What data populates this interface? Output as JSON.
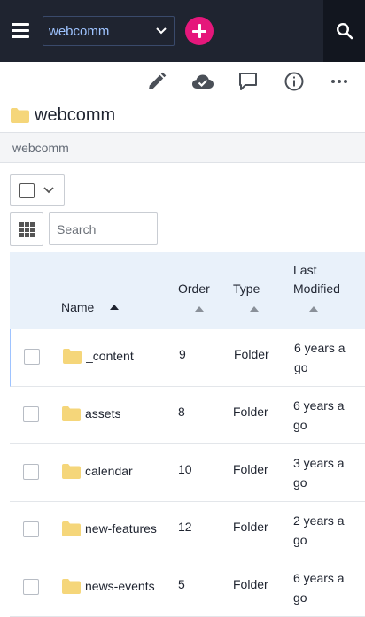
{
  "header": {
    "site_selector_value": "webcomm"
  },
  "icons": {
    "menu": "hamburger-icon",
    "add": "plus-icon",
    "search": "search-icon",
    "edit": "pencil-icon",
    "publish": "cloud-check-icon",
    "comment": "comment-icon",
    "info": "info-icon",
    "more": "more-icon",
    "folder": "folder-icon",
    "grid": "grid-icon"
  },
  "colors": {
    "topbar": "#1f2430",
    "accent_pink": "#e5177b",
    "link_blue": "#9ec3ff",
    "folder_yellow": "#f5d67a",
    "table_header": "#e9f1fa"
  },
  "page": {
    "title": "webcomm",
    "breadcrumb": "webcomm"
  },
  "controls": {
    "search_placeholder": "Search"
  },
  "table": {
    "columns": {
      "name": "Name",
      "order": "Order",
      "type": "Type",
      "last_modified_line1": "Last",
      "last_modified_line2": "Modified"
    },
    "rows": [
      {
        "name": "_content",
        "order": "9",
        "type": "Folder",
        "modified_line1": "6 years a",
        "modified_line2": "go"
      },
      {
        "name": "assets",
        "order": "8",
        "type": "Folder",
        "modified_line1": "6 years a",
        "modified_line2": "go"
      },
      {
        "name": "calendar",
        "order": "10",
        "type": "Folder",
        "modified_line1": "3 years a",
        "modified_line2": "go"
      },
      {
        "name": "new-features",
        "order": "12",
        "type": "Folder",
        "modified_line1": "2 years a",
        "modified_line2": "go"
      },
      {
        "name": "news-events",
        "order": "5",
        "type": "Folder",
        "modified_line1": "6 years a",
        "modified_line2": "go"
      }
    ]
  }
}
